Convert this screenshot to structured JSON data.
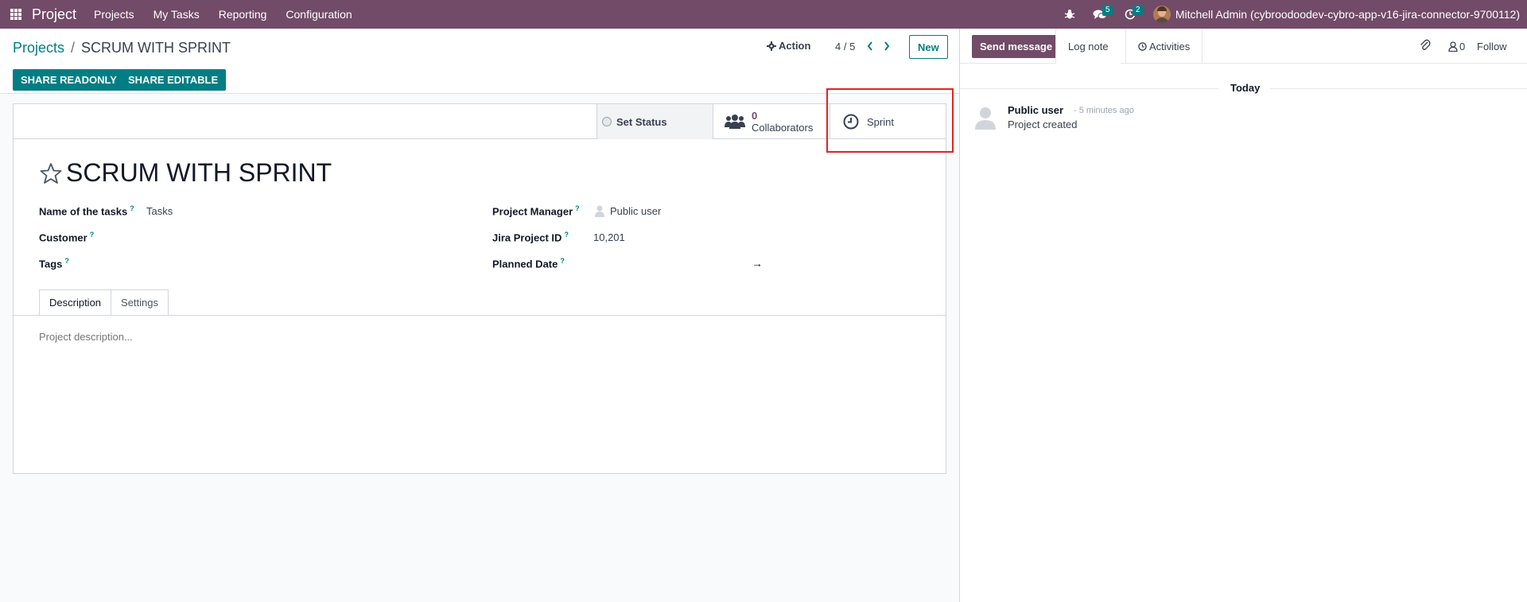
{
  "navbar": {
    "app_name": "Project",
    "menu": [
      "Projects",
      "My Tasks",
      "Reporting",
      "Configuration"
    ],
    "messages_count": "5",
    "activities_count": "2",
    "user_name": "Mitchell Admin (cybroodoodev-cybro-app-v16-jira-connector-9700112)"
  },
  "breadcrumb": {
    "parent": "Projects",
    "separator": "/",
    "current": "SCRUM WITH SPRINT"
  },
  "control": {
    "action_label": "Action",
    "pager": "4 / 5",
    "new_label": "New",
    "share_readonly": "SHARE READONLY",
    "share_editable": "SHARE EDITABLE"
  },
  "smart_buttons": {
    "status": "Set Status",
    "collaborators_count": "0",
    "collaborators_label": "Collaborators",
    "sprint": "Sprint"
  },
  "form": {
    "title": "SCRUM WITH SPRINT",
    "fields": {
      "name_of_tasks": {
        "label": "Name of the tasks",
        "value": "Tasks"
      },
      "customer": {
        "label": "Customer",
        "value": ""
      },
      "tags": {
        "label": "Tags",
        "value": ""
      },
      "project_manager": {
        "label": "Project Manager",
        "value": "Public user"
      },
      "jira_project_id": {
        "label": "Jira Project ID",
        "value": "10,201"
      },
      "planned_date": {
        "label": "Planned Date",
        "value": ""
      }
    },
    "help_mark": "?",
    "date_arrow": "→",
    "tabs": [
      "Description",
      "Settings"
    ],
    "description_placeholder": "Project description..."
  },
  "chatter": {
    "send_message": "Send message",
    "log_note": "Log note",
    "activities": "Activities",
    "followers_count": "0",
    "follow": "Follow",
    "day_label": "Today",
    "messages": [
      {
        "author": "Public user",
        "time": "- 5 minutes ago",
        "body": "Project created"
      }
    ]
  },
  "colors": {
    "brand": "#714b67",
    "accent": "#017e84",
    "highlight": "#e02424"
  }
}
